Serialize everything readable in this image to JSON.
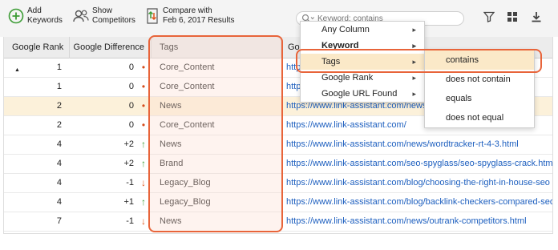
{
  "toolbar": {
    "add_keywords": [
      "Add",
      "Keywords"
    ],
    "show_competitors": [
      "Show",
      "Competitors"
    ],
    "compare": [
      "Compare with",
      "Feb 6, 2017 Results"
    ],
    "search_placeholder": "Keyword: contains"
  },
  "columns": {
    "rank": "Google Rank",
    "rank_sort": "▲",
    "diff": "Google Difference",
    "tags": "Tags",
    "url": "Goo"
  },
  "rows": [
    {
      "rank": "1",
      "diff": "0",
      "trend": "none",
      "tag": "Core_Content",
      "url": "https://www.link-assistant.com/"
    },
    {
      "rank": "1",
      "diff": "0",
      "trend": "none",
      "tag": "Core_Content",
      "url": "https://www.link-assistant.com/"
    },
    {
      "rank": "2",
      "diff": "0",
      "trend": "none",
      "tag": "News",
      "url": "https://www.link-assistant.com/news/"
    },
    {
      "rank": "2",
      "diff": "0",
      "trend": "none",
      "tag": "Core_Content",
      "url": "https://www.link-assistant.com/"
    },
    {
      "rank": "4",
      "diff": "+2",
      "trend": "up",
      "tag": "News",
      "url": "https://www.link-assistant.com/news/wordtracker-rt-4-3.html"
    },
    {
      "rank": "4",
      "diff": "+2",
      "trend": "up",
      "tag": "Brand",
      "url": "https://www.link-assistant.com/seo-spyglass/seo-spyglass-crack.html"
    },
    {
      "rank": "4",
      "diff": "-1",
      "trend": "down",
      "tag": "Legacy_Blog",
      "url": "https://www.link-assistant.com/blog/choosing-the-right-in-house-seo"
    },
    {
      "rank": "4",
      "diff": "+1",
      "trend": "up",
      "tag": "Legacy_Blog",
      "url": "https://www.link-assistant.com/blog/backlink-checkers-compared-seo"
    },
    {
      "rank": "7",
      "diff": "-1",
      "trend": "down",
      "tag": "News",
      "url": "https://www.link-assistant.com/news/outrank-competitors.html"
    }
  ],
  "selected_row": 2,
  "menu": {
    "items": [
      {
        "label": "Any Column",
        "submenu": true,
        "bold": false
      },
      {
        "label": "Keyword",
        "submenu": true,
        "bold": true
      },
      {
        "label": "Tags",
        "submenu": true,
        "bold": false
      },
      {
        "label": "Google Rank",
        "submenu": true,
        "bold": false
      },
      {
        "label": "Google URL Found",
        "submenu": true,
        "bold": false
      }
    ],
    "active_index": 2
  },
  "submenu": {
    "items": [
      "contains",
      "does not contain",
      "equals",
      "does not equal"
    ],
    "active_index": 0
  },
  "colors": {
    "highlight": "#e8643a",
    "selected_row": "#fcf1da",
    "link": "#1d5fbf",
    "trend_up": "#3c9c35",
    "trend_down": "#e0541b"
  }
}
